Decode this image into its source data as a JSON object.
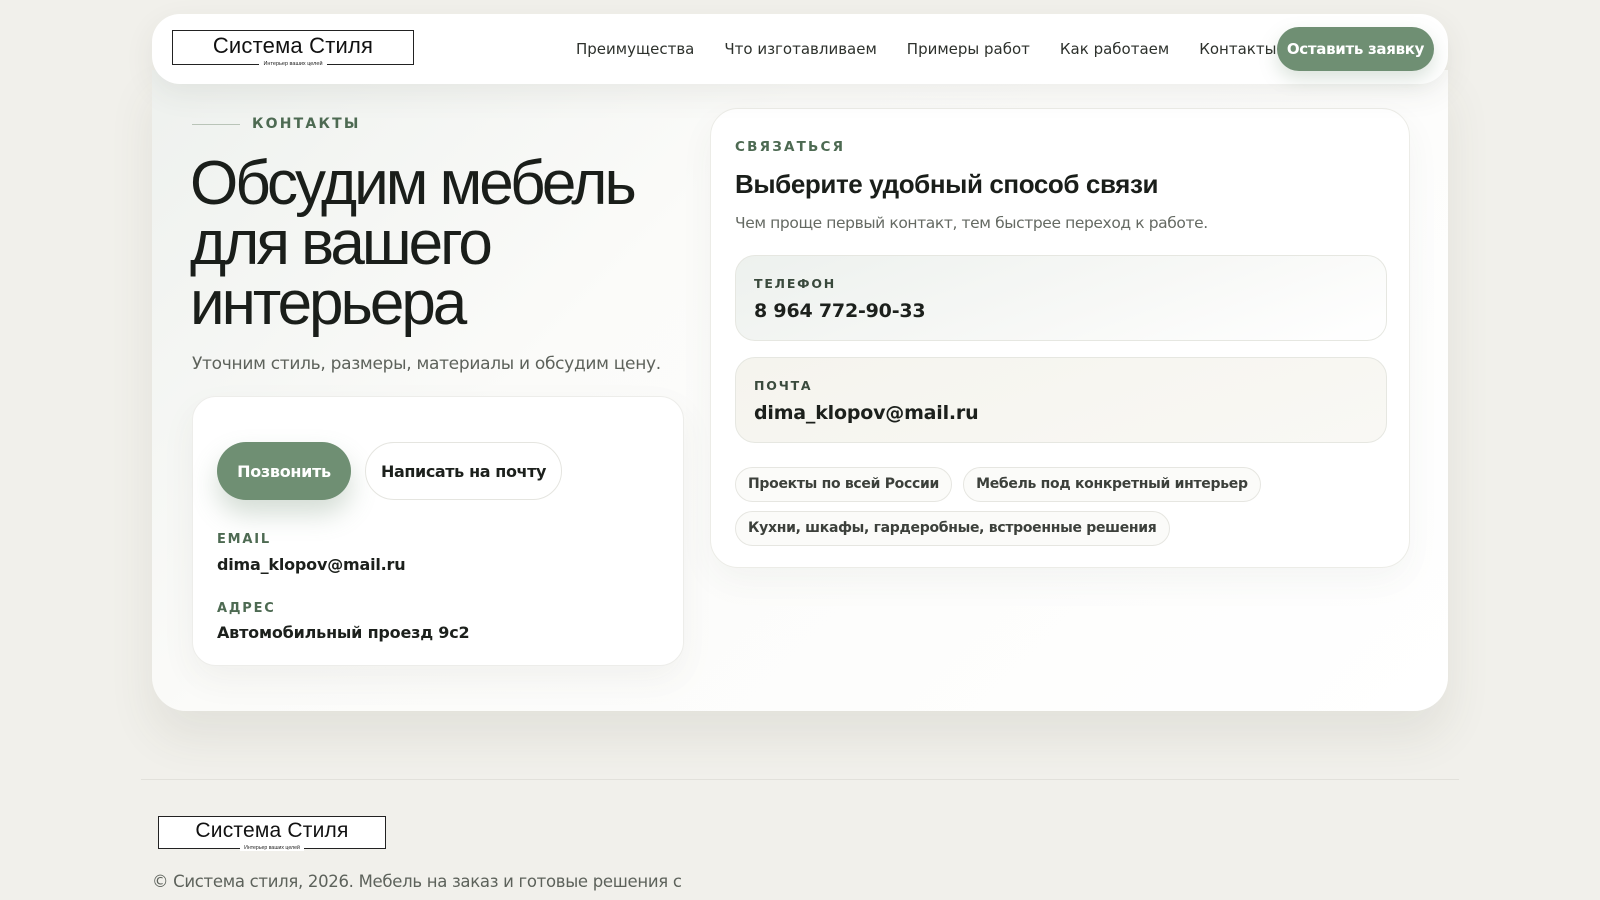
{
  "brand": {
    "name": "Система Стиля",
    "tagline": "Интерьер ваших целей"
  },
  "nav": {
    "items": [
      "Преимущества",
      "Что изготавливаем",
      "Примеры работ",
      "Как работаем",
      "Контакты"
    ],
    "cta_label": "Оставить заявку"
  },
  "contacts_section": {
    "eyebrow": "КОНТАКТЫ",
    "headline_lines": [
      "Обсудим мебель",
      "для вашего",
      "интерьера"
    ],
    "subtitle": "Уточним стиль, размеры, материалы и обсудим цену.",
    "call_button": "Позвонить",
    "mail_button": "Написать на почту",
    "email_label": "EMAIL",
    "email_value": "dima_klopov@mail.ru",
    "address_label": "АДРЕС",
    "address_value": "Автомобильный проезд 9с2"
  },
  "contact_card": {
    "eyebrow": "СВЯЗАТЬСЯ",
    "title": "Выберите удобный способ связи",
    "description": "Чем проще первый контакт, тем быстрее переход к работе.",
    "phone_label": "ТЕЛЕФОН",
    "phone_value": "8 964 772-90-33",
    "mail_label": "ПОЧТА",
    "mail_value": "dima_klopov@mail.ru",
    "chips": [
      "Проекты по всей России",
      "Мебель под конкретный интерьер",
      "Кухни, шкафы, гардеробные, встроенные решения"
    ]
  },
  "footer": {
    "copyright": "© Система стиля, 2026. Мебель на заказ и готовые решения с"
  },
  "colors": {
    "accent": "#6f8f73",
    "label_green": "#4d6a52",
    "background": "#f1f0eb"
  }
}
